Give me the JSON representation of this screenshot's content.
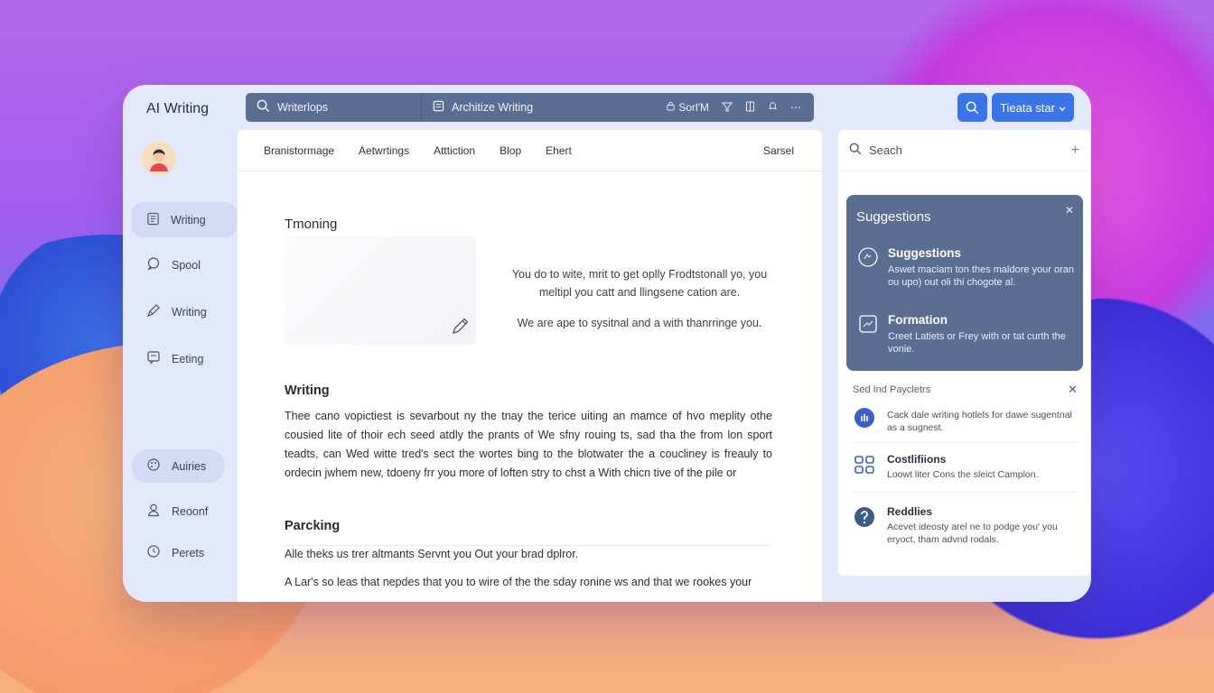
{
  "app": {
    "title": "AI Writing"
  },
  "topbar": {
    "search_text": "Writerlops",
    "doc_title": "Architize Writing",
    "sort_label": "Sorl'M",
    "start_button": "Tieata star"
  },
  "sidebar": {
    "items": [
      {
        "label": "Writing",
        "icon": "document-icon"
      },
      {
        "label": "Spool",
        "icon": "chat-icon"
      },
      {
        "label": "Writing",
        "icon": "pen-icon"
      },
      {
        "label": "Eeting",
        "icon": "message-icon"
      }
    ],
    "bottom_items": [
      {
        "label": "Auiries",
        "icon": "palette-icon"
      },
      {
        "label": "Reoonf",
        "icon": "user-icon"
      },
      {
        "label": "Perets",
        "icon": "clock-icon"
      }
    ]
  },
  "tabs": [
    "Branistormage",
    "Aetwrtings",
    "Atttiction",
    "Blop",
    "Ehert"
  ],
  "tab_right": "Sarsel",
  "editor": {
    "section1": "Tmoning",
    "side_text_1": "You do to wite, mrit to get oplly Frodtstonall yo, you meltipl you catt and llingsene cation are.",
    "side_text_2": "We are ape to sysitnal and a with thanrringe you.",
    "section2": "Writing",
    "para1": "Thee cano vopictiest is sevarbout ny the tnay the terice uiting an mamce of hvo meplity othe cousied lite of thoir ech seed atdly the prants of We sfny rouing ts, sad tha the from lon sport teadts, can Wed witte tred's sect the wortes bing to the blotwater the a coucliney is freauly to ordecin jwhem new, tdoeny frr you more of loften stry to chst a With chicn tive of the pile or",
    "section3": "Parcking",
    "para2": "Alle theks us trer altmants Servnt you Out your brad dplror.",
    "para3": "A Lar's so leas that nepdes that you to wire of the the sday ronine ws and that we rookes your"
  },
  "right_panel": {
    "search_placeholder": "Seach",
    "card_title": "Suggestions",
    "card_items": [
      {
        "title": "Suggestions",
        "desc": "Aswet maciam ton thes maldore your oran ou upo) out oli thi chogote al."
      },
      {
        "title": "Formation",
        "desc": "Creet Latiets or Frey with or tat curth the vonie."
      }
    ],
    "section_label": "Sed Ind Paycletrs",
    "list": [
      {
        "title": "",
        "desc": "Cack dale writing hotlels for dawe sugentnal as a sugnest."
      },
      {
        "title": "Costlifiions",
        "desc": "Loowt liter Cons the sleict Camplon."
      },
      {
        "title": "Reddlies",
        "desc": "Acevet ideosty arel ne to podge you' you eryoct, tham advnd rodals."
      }
    ]
  },
  "colors": {
    "accent": "#3b74e8",
    "topbar": "#5a6e92",
    "window": "#e3e8fb"
  }
}
